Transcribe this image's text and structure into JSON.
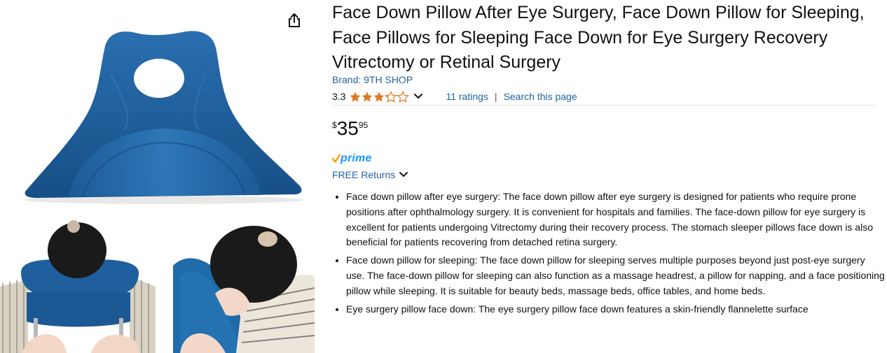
{
  "gallery": {
    "share_icon": "share-icon",
    "main_image": "blue-u-shaped-face-down-pillow",
    "thumbnails": [
      "person-using-pillow-back-view",
      "person-using-pillow-side-view"
    ],
    "pillow_color": "#1f5f9e"
  },
  "product": {
    "title": "Face Down Pillow After Eye Surgery, Face Down Pillow for Sleeping, Face Pillows for Sleeping Face Down for Eye Surgery Recovery Vitrectomy or Retinal Surgery",
    "brand": "Brand: 9TH SHOP",
    "rating": {
      "value": "3.3",
      "stars": 3.3,
      "stars_max": 5,
      "ratings_link": "11 ratings",
      "separator": "|",
      "search_link": "Search this page"
    },
    "price": {
      "symbol": "$",
      "whole": "35",
      "fraction": "95"
    },
    "prime_label": "prime",
    "returns": "FREE Returns",
    "bullets": [
      "Face down pillow after eye surgery: The face down pillow after eye surgery is designed for patients who require prone positions after ophthalmology surgery. It is convenient for hospitals and families. The face-down pillow for eye surgery is excellent for patients undergoing Vitrectomy during their recovery process. The stomach sleeper pillows face down is also beneficial for patients recovering from detached retina surgery.",
      "Face down pillow for sleeping: The face down pillow for sleeping serves multiple purposes beyond just post-eye surgery use. The face-down pillow for sleeping can also function as a massage headrest, a pillow for napping, and a face positioning pillow while sleeping. It is suitable for beauty beds, massage beds, office tables, and home beds.",
      "Eye surgery pillow face down: The eye surgery pillow face down features a skin-friendly flannelette surface"
    ]
  },
  "colors": {
    "link": "#2162a1",
    "star": "#de7921",
    "prime": "#1399ff",
    "prime_check": "#ff9900",
    "text": "#0f1111"
  }
}
